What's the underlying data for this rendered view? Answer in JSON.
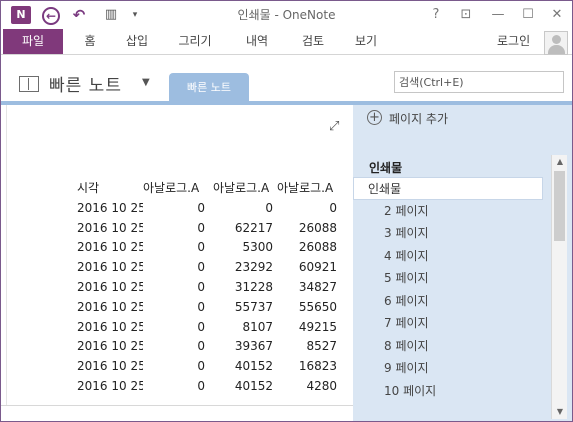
{
  "titlebar": {
    "app_icon_text": "N",
    "title": "인쇄물 - OneNote",
    "help": "?",
    "ribbon_display": "⊡",
    "minimize": "—",
    "maximize": "☐",
    "close": "✕"
  },
  "quick_access": {
    "back": "←",
    "undo": "↶",
    "dock": "▥",
    "customize": "▾"
  },
  "tabs": {
    "file": "파일",
    "home": "홈",
    "insert": "삽입",
    "draw": "그리기",
    "history": "내역",
    "review": "검토",
    "view": "보기"
  },
  "signin": "로그인",
  "notebook": {
    "title": "빠른 노트",
    "caret": "▼",
    "section_tab": "빠른 노트"
  },
  "search": {
    "placeholder": "검색(Ctrl+E)"
  },
  "canvas": {
    "expand": "⤢",
    "headers": [
      "시각",
      "아날로그.A",
      "아날로그.A",
      "아날로그.A"
    ],
    "rows": [
      [
        "2016 10 25",
        "0",
        "0",
        "0"
      ],
      [
        "2016 10 25",
        "0",
        "62217",
        "26088"
      ],
      [
        "2016 10 25",
        "0",
        "5300",
        "26088"
      ],
      [
        "2016 10 25",
        "0",
        "23292",
        "60921"
      ],
      [
        "2016 10 25",
        "0",
        "31228",
        "34827"
      ],
      [
        "2016 10 25",
        "0",
        "55737",
        "55650"
      ],
      [
        "2016 10 25",
        "0",
        "8107",
        "49215"
      ],
      [
        "2016 10 25",
        "0",
        "39367",
        "8527"
      ],
      [
        "2016 10 25",
        "0",
        "40152",
        "16823"
      ],
      [
        "2016 10 25",
        "0",
        "40152",
        "4280"
      ]
    ]
  },
  "pages": {
    "add_page": "페이지 추가",
    "add_icon": "+",
    "section_title": "인쇄물",
    "items": [
      "인쇄물",
      "2 페이지",
      "3 페이지",
      "4 페이지",
      "5 페이지",
      "6 페이지",
      "7 페이지",
      "8 페이지",
      "9 페이지",
      "10 페이지"
    ],
    "selected_index": 0,
    "scroll_up": "▲",
    "scroll_down": "▼"
  }
}
